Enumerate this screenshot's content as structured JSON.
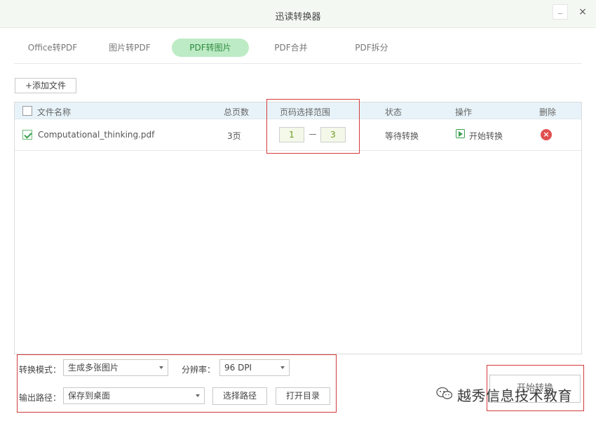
{
  "window": {
    "title": "迅读转换器",
    "minimize_label": "–",
    "close_label": "×"
  },
  "tabs": [
    {
      "label": "Office转PDF",
      "active": false
    },
    {
      "label": "图片转PDF",
      "active": false
    },
    {
      "label": "PDF转图片",
      "active": true
    },
    {
      "label": "PDF合并",
      "active": false
    },
    {
      "label": "PDF拆分",
      "active": false
    }
  ],
  "toolbar": {
    "add_file_label": "+添加文件"
  },
  "table": {
    "columns": {
      "name": "文件名称",
      "pages": "总页数",
      "range": "页码选择范围",
      "status": "状态",
      "action": "操作",
      "delete": "删除"
    },
    "rows": [
      {
        "checked": true,
        "name": "Computational_thinking.pdf",
        "pages": "3页",
        "range_start": "1",
        "range_end": "3",
        "status": "等待转换",
        "action": "开始转换"
      }
    ]
  },
  "options": {
    "mode_label": "转换模式：",
    "mode_value": "生成多张图片",
    "resolution_label": "分辨率：",
    "resolution_value": "96  DPI",
    "output_label": "输出路径：",
    "output_value": "保存到桌面",
    "choose_path_label": "选择路径",
    "open_dir_label": "打开目录"
  },
  "start_button_label": "开始转换",
  "watermark_text": "越秀信息技术教育",
  "colors": {
    "accent_green": "#3aa04d",
    "active_tab_bg": "#bdebc5",
    "highlight_red": "#d43b3b",
    "delete_red": "#e05050"
  }
}
